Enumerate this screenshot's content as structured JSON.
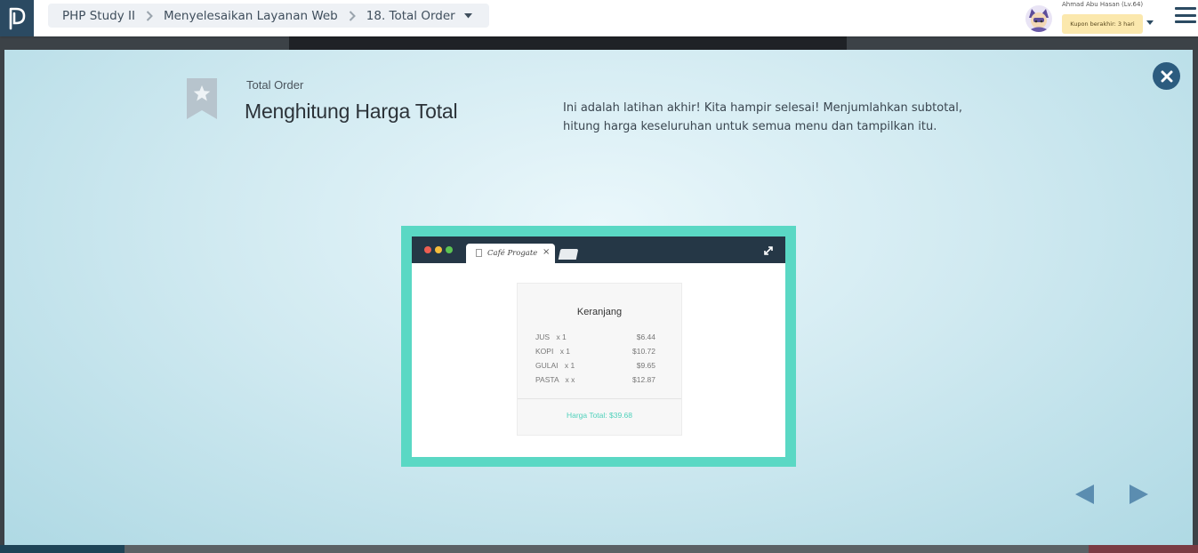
{
  "breadcrumb": {
    "course": "PHP Study II",
    "chapter": "Menyelesaikan Layanan Web",
    "lesson": "18. Total Order"
  },
  "user": {
    "name": "Ahmad Abu Hasan (Lv.64)",
    "coupon": "Kupon berakhir: 3 hari"
  },
  "modal": {
    "subtitle": "Total Order",
    "title": "Menghitung Harga Total",
    "description": "Ini adalah latihan akhir! Kita hampir selesai! Menjumlahkan subtotal, hitung harga keseluruhan untuk semua menu dan tampilkan itu."
  },
  "preview": {
    "tab_title": "Café Progate",
    "cart_title": "Keranjang",
    "items": [
      {
        "name": "JUS",
        "qty": "x 1",
        "price": "$6.44"
      },
      {
        "name": "KOPI",
        "qty": "x 1",
        "price": "$10.72"
      },
      {
        "name": "GULAI",
        "qty": "x 1",
        "price": "$9.65"
      },
      {
        "name": "PASTA",
        "qty": "x x",
        "price": "$12.87"
      }
    ],
    "total": "Harga Total: $39.68"
  },
  "colors": {
    "accent": "#5ad8c4",
    "close_button": "#2c5c7f",
    "nav_arrow": "#5b8db0",
    "logo_bg": "#2b4a62",
    "coupon_bg": "#fbe8ad"
  },
  "icons": [
    "logo-icon",
    "chevron-right-icon",
    "caret-down-icon",
    "menu-icon",
    "bookmark-star-icon",
    "close-icon",
    "expand-icon",
    "arrow-left-icon",
    "arrow-right-icon"
  ]
}
